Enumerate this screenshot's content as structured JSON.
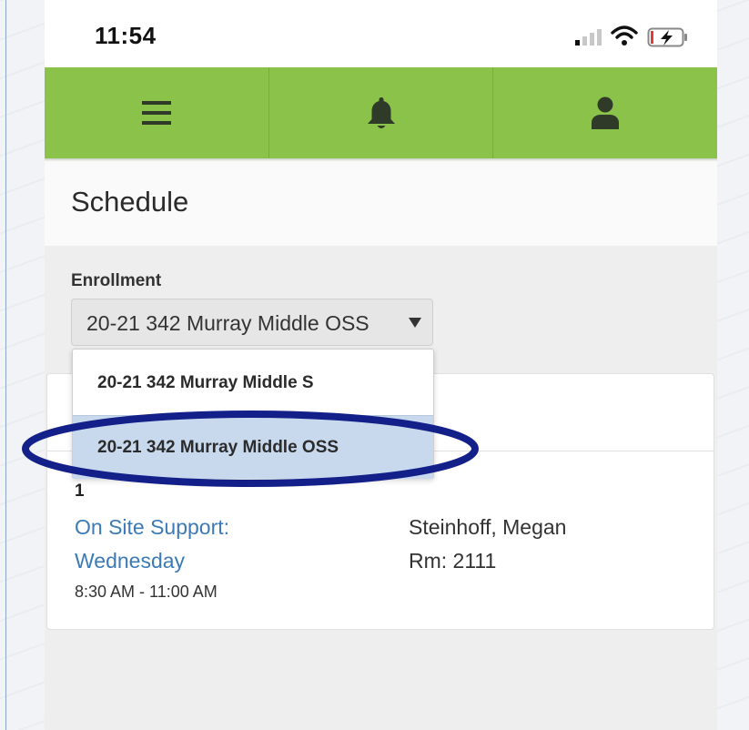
{
  "status_bar": {
    "time": "11:54",
    "signal_icon": "cellular-signal-icon",
    "wifi_icon": "wifi-icon",
    "battery_icon": "battery-charging-low-icon"
  },
  "nav": {
    "items": [
      {
        "icon": "hamburger-menu-icon"
      },
      {
        "icon": "bell-icon"
      },
      {
        "icon": "user-icon"
      }
    ],
    "color": "#8bc34a"
  },
  "page": {
    "title": "Schedule"
  },
  "enrollment": {
    "label": "Enrollment",
    "selected": "20-21 342 Murray Middle OSS",
    "options": [
      "20-21 342 Murray Middle S",
      "20-21 342 Murray Middle OSS"
    ]
  },
  "schedule": {
    "period": "1",
    "course_line1": "On Site Support:",
    "course_line2": "Wednesday",
    "time_range": "8:30 AM - 11:00 AM",
    "teacher": "Steinhoff, Megan",
    "room": "Rm: 2111"
  },
  "colors": {
    "accent_green": "#8bc34a",
    "link_blue": "#3c7ab5",
    "selected_option": "#c8d9ee",
    "annotation_ellipse": "#14208a"
  }
}
